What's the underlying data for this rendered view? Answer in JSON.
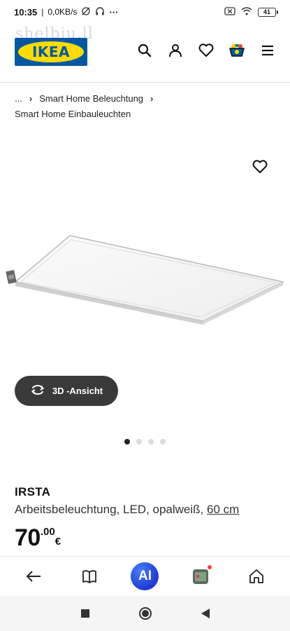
{
  "status_bar": {
    "time": "10:35",
    "speed": "0,0KB/s",
    "battery": "41"
  },
  "header": {
    "watermark": "shelbiu.ll",
    "logo_text": "IKEA",
    "icons": [
      "search-icon",
      "account-icon",
      "favorites-icon",
      "cart-icon",
      "menu-icon"
    ]
  },
  "breadcrumb": {
    "ellipsis": "...",
    "separator": "›",
    "parent": "Smart Home Beleuchtung",
    "current": "Smart Home Einbauleuchten"
  },
  "gallery": {
    "view_3d_label": "3D -Ansicht",
    "page_count": 4,
    "active_page": 1
  },
  "product": {
    "name": "IRSTA",
    "description": "Arbeitsbeleuchtung, LED, opalweiß, ",
    "size": "60 cm",
    "price_integer": "70",
    "price_decimal": ".00",
    "currency": "€"
  },
  "browser_bar": {
    "ai_label": "AI",
    "icons": [
      "back-icon",
      "book-icon",
      "ai-icon",
      "game-icon",
      "home-icon"
    ]
  },
  "colors": {
    "ikea_blue": "#0058a3",
    "ikea_yellow": "#ffdb00",
    "button_dark": "#3a3a3a"
  }
}
